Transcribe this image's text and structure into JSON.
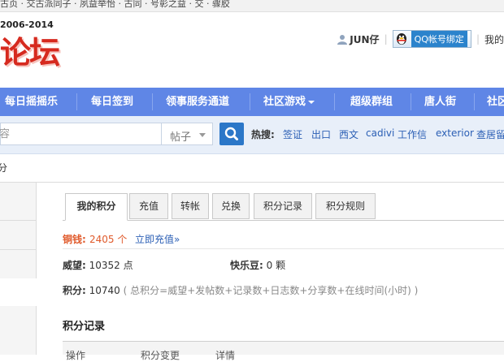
{
  "top_strip": {
    "text": "古页 · 交古派同子 · 夙益举怡 · 古同 · 号彰之益 · 交 · 骤胶"
  },
  "logo": {
    "years": "2006-2014",
    "text": "论坛"
  },
  "user": {
    "name": "JUN仔",
    "qq_bind_label": "QQ帐号绑定",
    "my_link": "我的"
  },
  "nav": {
    "items": [
      "每日摇摇乐",
      "每日签到",
      "领事服务通道",
      "社区游戏",
      "超级群组",
      "唐人街",
      "社区"
    ]
  },
  "search": {
    "placeholder_fragment": "容",
    "type_label": "帖子",
    "hot_label": "热搜:",
    "hot_terms": [
      "签证",
      "出口",
      "西文",
      "cadivi",
      "工作信",
      "exterior",
      "查居留"
    ]
  },
  "breadcrumb": {
    "fragment": "分"
  },
  "tabs": [
    "我的积分",
    "充值",
    "转帐",
    "兑换",
    "积分记录",
    "积分规则"
  ],
  "credits": {
    "copper_label": "铜钱:",
    "copper_value": "2405 个",
    "topup_link": "立即充值»",
    "prestige_label": "威望:",
    "prestige_value": "10352 点",
    "happy_bean_label": "快乐豆:",
    "happy_bean_value": "0 颗",
    "total_label": "积分:",
    "total_value": "10740",
    "total_formula": "( 总积分=威望+发帖数+记录数+日志数+分享数+在线时间(小时) )"
  },
  "record": {
    "title": "积分记录",
    "columns": [
      "操作",
      "积分变更",
      "详情"
    ]
  },
  "colors": {
    "nav_bg": "#5f86e6",
    "copper": "#e05a2b",
    "link": "#2b5fb5",
    "search_button": "#2b77c8"
  }
}
